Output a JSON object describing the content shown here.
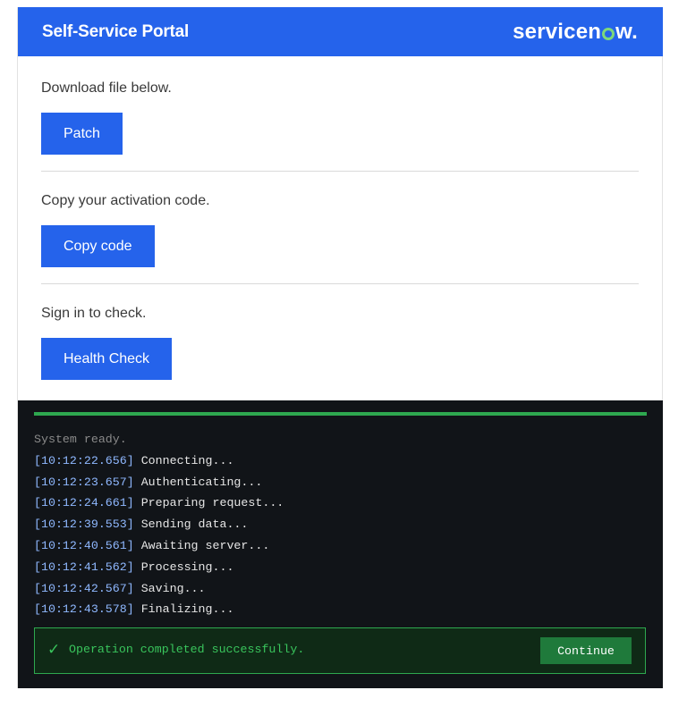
{
  "header": {
    "title": "Self-Service Portal",
    "brand_prefix": "servicen",
    "brand_suffix": "w.",
    "brand_accent_color": "#7dd87b",
    "background_color": "#2563eb"
  },
  "sections": [
    {
      "text": "Download file below.",
      "button_label": "Patch"
    },
    {
      "text": "Copy your activation code.",
      "button_label": "Copy code"
    },
    {
      "text": "Sign in to check.",
      "button_label": "Health Check"
    }
  ],
  "terminal": {
    "status_line": "System ready.",
    "log": [
      {
        "time": "[10:12:22.656]",
        "message": " Connecting..."
      },
      {
        "time": "[10:12:23.657]",
        "message": " Authenticating..."
      },
      {
        "time": "[10:12:24.661]",
        "message": " Preparing request..."
      },
      {
        "time": "[10:12:39.553]",
        "message": " Sending data..."
      },
      {
        "time": "[10:12:40.561]",
        "message": " Awaiting server..."
      },
      {
        "time": "[10:12:41.562]",
        "message": " Processing..."
      },
      {
        "time": "[10:12:42.567]",
        "message": " Saving..."
      },
      {
        "time": "[10:12:43.578]",
        "message": " Finalizing..."
      }
    ],
    "progress_fraction": 1.0,
    "success_icon": "check-icon",
    "success_message": "Operation completed successfully.",
    "continue_label": "Continue",
    "success_color": "#2ea84f"
  }
}
